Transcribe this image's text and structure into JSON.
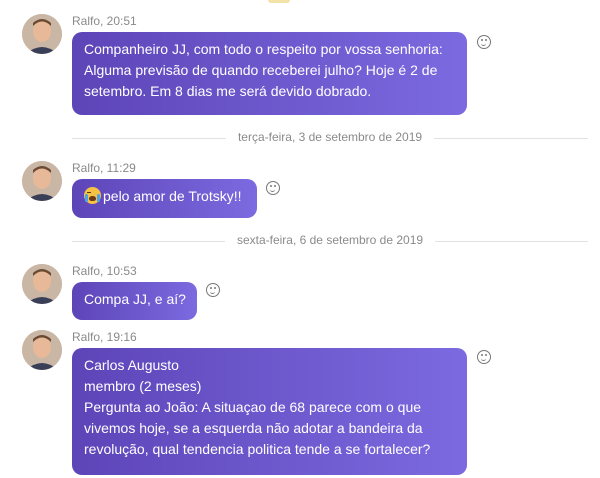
{
  "messages": [
    {
      "author": "Ralfo",
      "time": "20:51",
      "meta": "Ralfo, 20:51",
      "lines": [
        "Companheiro JJ, com todo o respeito por vossa senhoria:",
        "Alguma previsão de quando receberei julho? Hoje é 2 de",
        "setembro. Em 8 dias me será devido dobrado."
      ]
    },
    {
      "author": "Ralfo",
      "time": "11:29",
      "meta": "Ralfo, 11:29",
      "emoji": "crying-face",
      "text": "pelo amor de Trotsky!!"
    },
    {
      "author": "Ralfo",
      "time": "10:53",
      "meta": "Ralfo, 10:53",
      "text": "Compa JJ, e aí?"
    },
    {
      "author": "Ralfo",
      "time": "19:16",
      "meta": "Ralfo, 19:16",
      "lines": [
        "Carlos Augusto",
        "membro (2 meses)",
        "Pergunta ao João: A situaçao de 68 parece com o que",
        "vivemos hoje, se a esquerda não adotar a bandeira da",
        "revolução, qual tendencia politica tende a se fortalecer?"
      ]
    }
  ],
  "dividers": [
    "terça-feira, 3 de setembro de 2019",
    "sexta-feira, 6 de setembro de 2019"
  ],
  "icons": {
    "reaction": "smiley-reaction-icon",
    "avatar": "user-avatar"
  },
  "colors": {
    "bubble_start": "#5d45b8",
    "bubble_end": "#7c6ae0",
    "meta_text": "#8a8a8a",
    "divider_line": "#e2e2e2"
  }
}
